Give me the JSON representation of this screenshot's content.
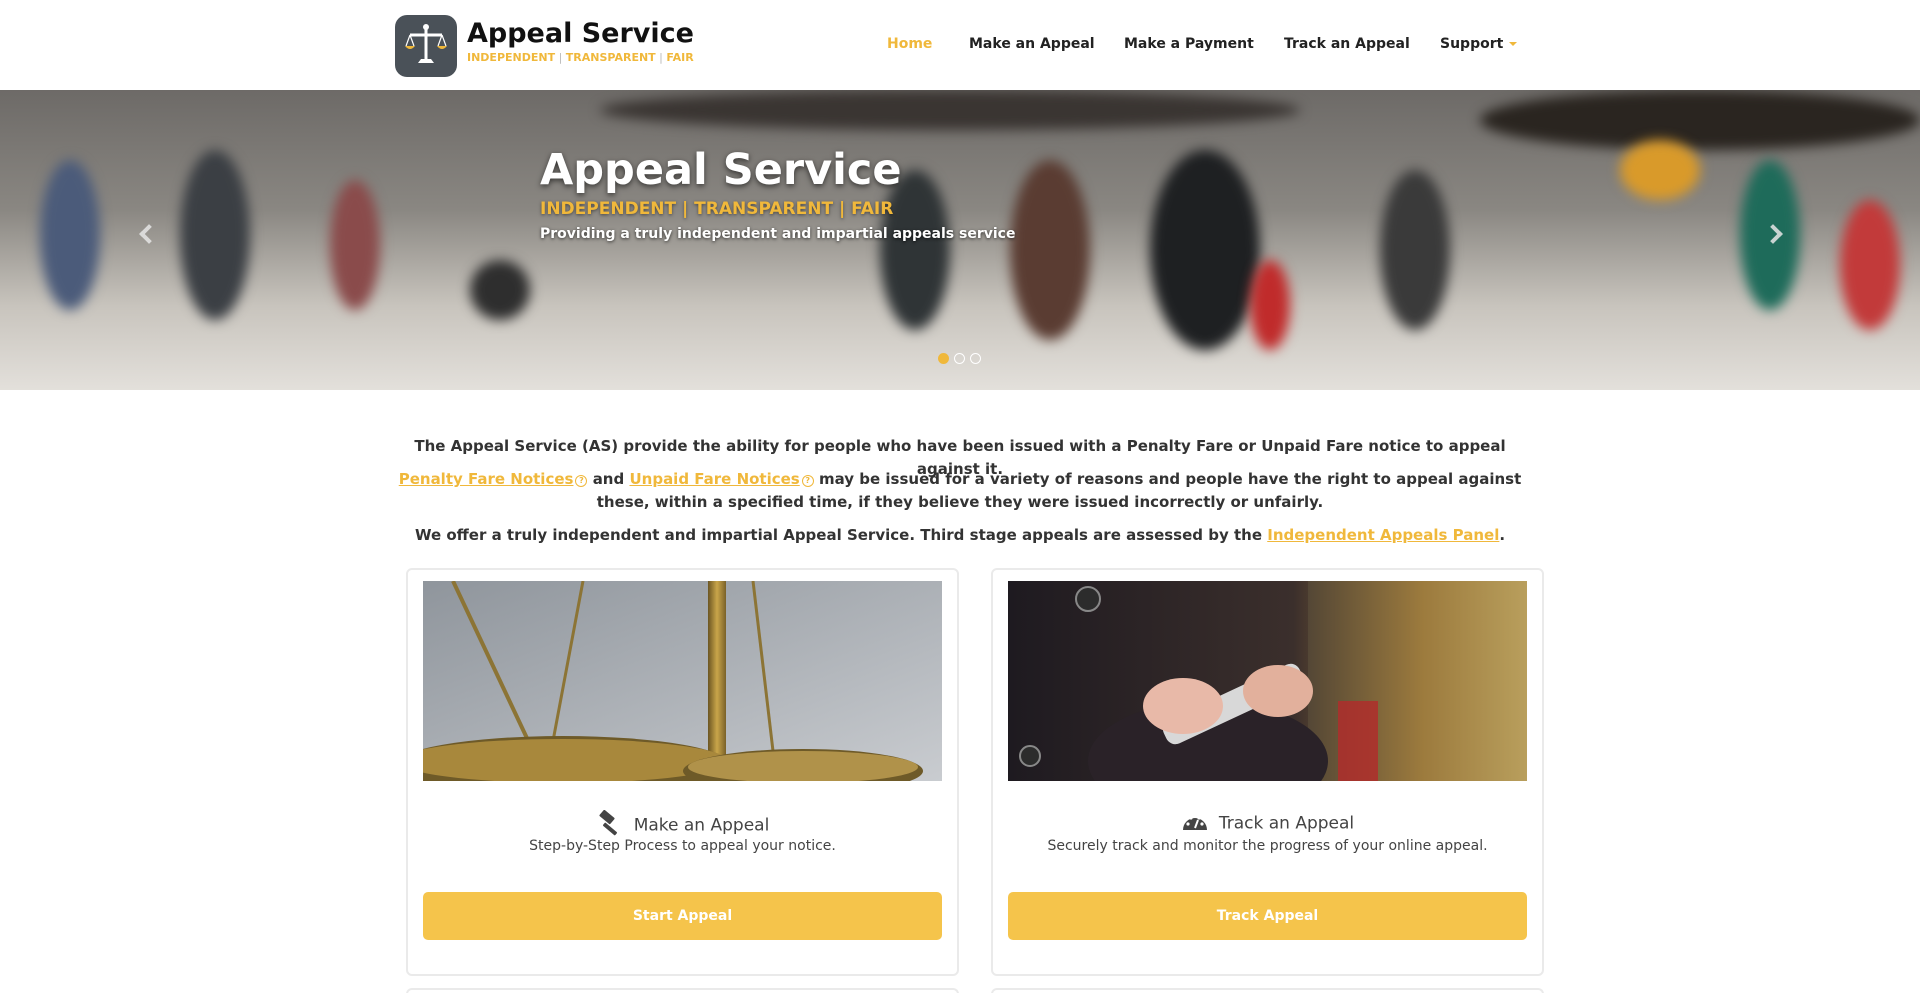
{
  "header": {
    "brand_title": "Appeal Service",
    "brand_tag": [
      "INDEPENDENT",
      "TRANSPARENT",
      "FAIR"
    ],
    "nav": [
      {
        "label": "Home",
        "active": true
      },
      {
        "label": "Make an Appeal"
      },
      {
        "label": "Make a Payment"
      },
      {
        "label": "Track an Appeal"
      },
      {
        "label": "Support",
        "dropdown": true
      }
    ],
    "logo_icon": "scales-icon"
  },
  "hero": {
    "title": "Appeal Service",
    "tagline": "INDEPENDENT | TRANSPARENT | FAIR",
    "subtitle": "Providing a truly independent and impartial appeals service",
    "slides": 3,
    "active_slide": 1,
    "prev_icon": "chevron-left-icon",
    "next_icon": "chevron-right-icon"
  },
  "intro": {
    "p1": "The Appeal Service (AS) provide the ability for people who have been issued with a Penalty Fare or Unpaid Fare notice to appeal against it.",
    "link_penalty": "Penalty Fare Notices",
    "and": "and",
    "link_unpaid": "Unpaid Fare Notices",
    "p2_rest": "may be issued for a variety of reasons and people have the right to appeal against these, within a specified time, if they believe they were issued incorrectly or unfairly.",
    "p3": "We offer a truly independent and impartial Appeal Service. Third stage appeals are assessed by the",
    "link_panel": "Independent Appeals Panel",
    "p3_end": "."
  },
  "cards": [
    {
      "title": "Make an Appeal",
      "icon": "gavel-icon",
      "description": "Step-by-Step Process to appeal your notice.",
      "button": "Start Appeal"
    },
    {
      "title": "Track an Appeal",
      "icon": "dashboard-icon",
      "description": "Securely track and monitor the progress of your online appeal.",
      "button": "Track Appeal"
    }
  ],
  "colors": {
    "accent": "#f0b83b",
    "button": "#f5c44b",
    "logo_bg": "#4a5158"
  }
}
